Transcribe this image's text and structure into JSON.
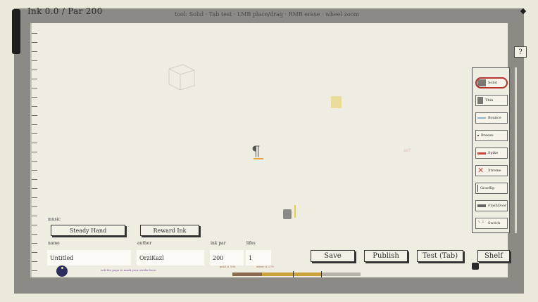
{
  "header": {
    "ink_text": "Ink 0.0 / Par 200",
    "hint_text": "tool: Solid  ·  Tab test · LMB place/drag · RMB erase · wheel zoom"
  },
  "help_label": "?",
  "canvas": {
    "pilcrow": "¶",
    "faint_mark": "so?"
  },
  "palette": {
    "items": [
      {
        "label": "Solid",
        "active": true
      },
      {
        "label": "Thin",
        "active": false
      },
      {
        "label": "Bounce",
        "active": false
      },
      {
        "label": "Breeze",
        "active": false
      },
      {
        "label": "Spike",
        "active": false
      },
      {
        "label": "Xtreme",
        "active": false
      },
      {
        "label": "Gravflip",
        "active": false
      },
      {
        "label": "FlashDoor",
        "active": false
      },
      {
        "label": "Switch",
        "active": false
      }
    ]
  },
  "form": {
    "music_label": "music",
    "music_options": [
      "Steady Hand",
      "Reward Ink"
    ],
    "name_label": "name",
    "name_value": "Untitled",
    "author_label": "author",
    "author_value": "OrziKazl",
    "inkpar_label": "ink par",
    "inkpar_value": "200",
    "inkpar_sub_gold": "gold ≤ 190",
    "inkpar_sub_silver": "silver ≤ 270",
    "lives_label": "lifes",
    "lives_value": "1",
    "tip": "ook the page to mark your stroke here"
  },
  "actions": {
    "save": "Save",
    "publish": "Publish",
    "test": "Test (Tab)",
    "shelf": "Shelf"
  },
  "bar": {
    "colors": [
      "#8b6a52",
      "#c9a33a",
      "#b5b2a8"
    ],
    "values": [
      0.23,
      0.46,
      0.31
    ]
  }
}
